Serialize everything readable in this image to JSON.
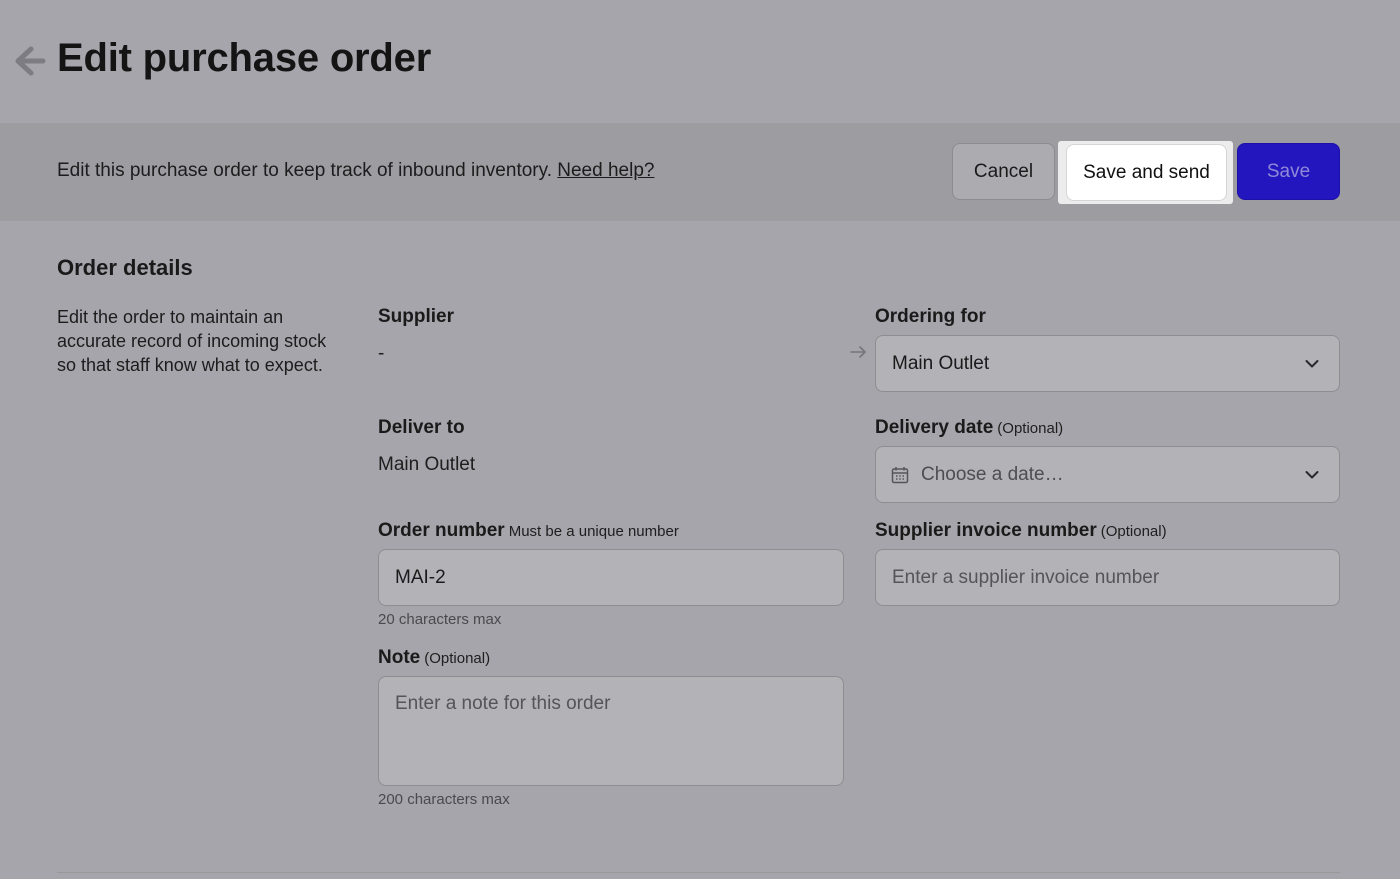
{
  "header": {
    "back_icon": "arrow-left-icon",
    "title": "Edit purchase order"
  },
  "banner": {
    "text": "Edit this purchase order to keep track of inbound inventory.",
    "help_link": "Need help?",
    "cancel_label": "Cancel",
    "save_and_send_label": "Save and send",
    "save_label": "Save",
    "save_color": "#2416bf"
  },
  "order_details": {
    "title": "Order details",
    "description": "Edit the order to maintain an accurate record of incoming stock so that staff know what to expect.",
    "supplier": {
      "label": "Supplier",
      "value": "-"
    },
    "ordering_for": {
      "label": "Ordering for",
      "value": "Main Outlet"
    },
    "deliver_to": {
      "label": "Deliver to",
      "value": "Main Outlet"
    },
    "delivery_date": {
      "label": "Delivery date",
      "hint": "(Optional)",
      "placeholder": "Choose a date…"
    },
    "order_number": {
      "label": "Order number",
      "hint": "Must be a unique number",
      "value": "MAI-2",
      "helper": "20 characters max"
    },
    "supplier_invoice": {
      "label": "Supplier invoice number",
      "hint": "(Optional)",
      "placeholder": "Enter a supplier invoice number"
    },
    "note": {
      "label": "Note",
      "hint": "(Optional)",
      "placeholder": "Enter a note for this order",
      "helper": "200 characters max"
    }
  }
}
